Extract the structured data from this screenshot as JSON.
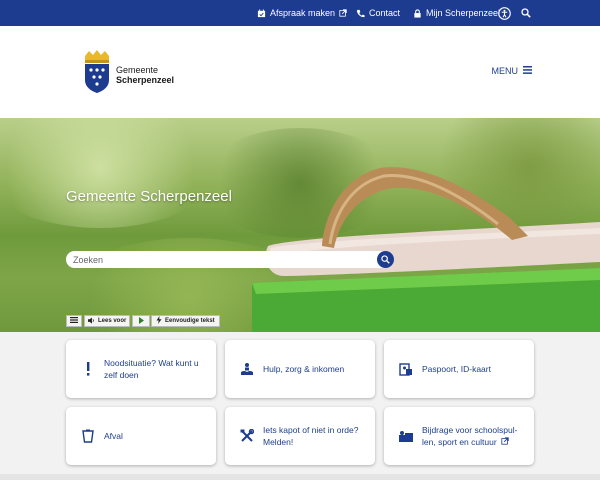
{
  "topbar": {
    "appointment": "Afspraak maken",
    "contact": "Contact",
    "my_account": "Mijn Scherpenzeel"
  },
  "logo": {
    "line1": "Gemeente",
    "line2": "Scherpenzeel"
  },
  "menu": {
    "label": "MENU"
  },
  "hero": {
    "title": "Gemeente Scherpenzeel",
    "search_placeholder": "Zoeken"
  },
  "readspeaker": {
    "read_label": "Lees voor",
    "simple_text": "Eenvoudige tekst"
  },
  "cards": [
    {
      "label": "Noodsituatie? Wat kunt u zelf doen",
      "icon": "exclamation-icon"
    },
    {
      "label": "Hulp, zorg & inkomen",
      "icon": "help-hands-icon"
    },
    {
      "label": "Paspoort, ID-kaart",
      "icon": "id-card-icon"
    },
    {
      "label": "Afval",
      "icon": "waste-bin-icon"
    },
    {
      "label": "Iets kapot of niet in orde? Melden!",
      "icon": "tools-icon"
    },
    {
      "label": "Bijdrage voor schoolspul-len, sport en cultuur",
      "icon": "contribution-icon"
    }
  ],
  "colors": {
    "brand_blue": "#1d3c8f",
    "link_blue": "#1f3f8a",
    "background": "#f2f2f2"
  }
}
